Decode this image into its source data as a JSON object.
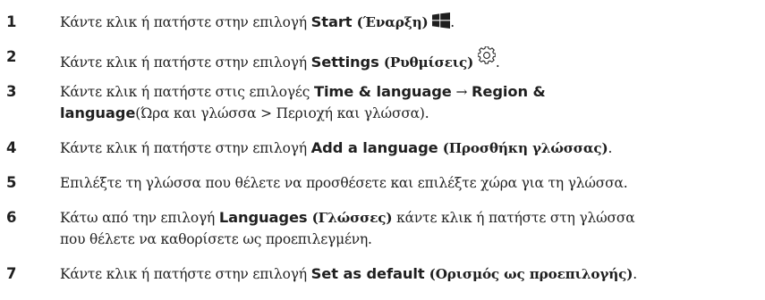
{
  "steps": [
    {
      "number": "1",
      "pre": "Κάντε κλικ ή πατήστε στην επιλογή ",
      "ui": "Start",
      "ui_gr": " (Έναρξη)",
      "icon": "windows-logo-icon",
      "post": "."
    },
    {
      "number": "2",
      "pre": "Κάντε κλικ ή πατήστε στην επιλογή ",
      "ui": "Settings",
      "ui_gr": " (Ρυθμίσεις)",
      "icon": "gear-icon",
      "post": "."
    },
    {
      "number": "3",
      "pre": "Κάντε κλικ ή πατήστε στις επιλογές ",
      "ui": "Time & language",
      "arrow": " → ",
      "ui2": "Region &",
      "ui3": "language",
      "post": "(Ώρα και γλώσσα > Περιοχή και γλώσσα)."
    },
    {
      "number": "4",
      "pre": "Κάντε κλικ ή πατήστε στην επιλογή ",
      "ui": "Add a language",
      "ui_gr": " (Προσθήκη γλώσσας)",
      "post": "."
    },
    {
      "number": "5",
      "text": "Επιλέξτε τη γλώσσα που θέλετε να προσθέσετε και επιλέξτε χώρα για τη γλώσσα."
    },
    {
      "number": "6",
      "pre": "Κάτω από την επιλογή ",
      "ui": "Languages",
      "ui_gr": " (Γλώσσες)",
      "post": " κάντε κλικ ή πατήστε στη γλώσσα",
      "line2": "που θέλετε να καθορίσετε ως προεπιλεγμένη."
    },
    {
      "number": "7",
      "pre": "Κάντε κλικ ή πατήστε στην επιλογή ",
      "ui": "Set as default",
      "ui_gr": " (Ορισμός ως προεπιλογής)",
      "post": "."
    }
  ],
  "colors": {
    "text": "#222222",
    "icon": "#1f1f1f"
  }
}
